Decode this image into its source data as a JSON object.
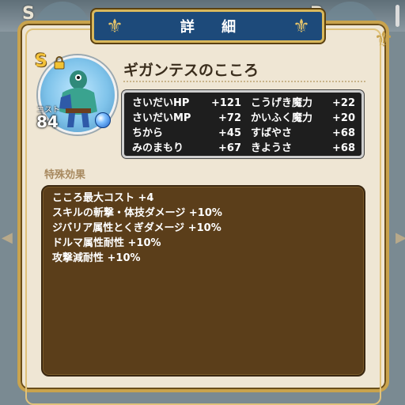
{
  "background": {
    "left_rank": "S",
    "right_rank": "B"
  },
  "header": {
    "title": "詳 細"
  },
  "monster": {
    "rank": "S",
    "cost_label": "コスト",
    "cost": "84",
    "name": "ギガンテスのこころ"
  },
  "stats": [
    {
      "left_name": "さいだいHP",
      "left_value": "+121",
      "right_name": "こうげき魔力",
      "right_value": "+22"
    },
    {
      "left_name": "さいだいMP",
      "left_value": "+72",
      "right_name": "かいふく魔力",
      "right_value": "+20"
    },
    {
      "left_name": "ちから",
      "left_value": "+45",
      "right_name": "すばやさ",
      "right_value": "+68"
    },
    {
      "left_name": "みのまもり",
      "left_value": "+67",
      "right_name": "きようさ",
      "right_value": "+68"
    }
  ],
  "effects": {
    "label": "特殊効果",
    "items": [
      "こころ最大コスト +4",
      "スキルの斬撃・体技ダメージ +10%",
      "ジバリア属性とくぎダメージ +10%",
      "ドルマ属性耐性 +10%",
      "攻撃減耐性 +10%"
    ]
  },
  "colors": {
    "title_plate": "#1d4a7a",
    "gold_border": "#c9a34d",
    "card_bg": "#efe6d4",
    "stats_bg": "#1e1e1e",
    "effects_bg": "#5b3e1a"
  },
  "icons": [
    "lock-icon",
    "fleur-de-lis-icon",
    "orb-icon",
    "corner-ornament-icon"
  ]
}
